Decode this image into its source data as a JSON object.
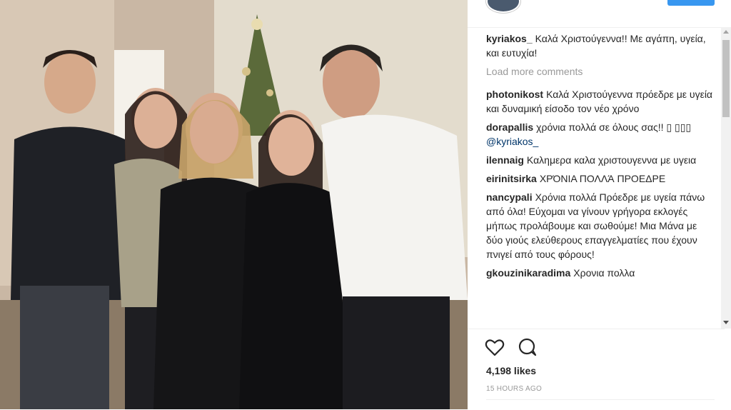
{
  "post": {
    "caption": {
      "username": "kyriakos_",
      "text": "Καλά Χριστούγεννα!! Με αγάπη, υγεία, και ευτυχία!"
    },
    "load_more": "Load more comments",
    "comments": [
      {
        "username": "photonikost",
        "text": "Καλά Χριστούγεννα πρόεδρε με υγεία και δυναμική είσοδο τον νέο χρόνο"
      },
      {
        "username": "dorapallis",
        "text": "χρόνια πολλά σε όλους σας!! ▯ ▯▯▯",
        "mention": "@kyriakos_"
      },
      {
        "username": "ilennaig",
        "text": "Καλημερα καλα χριστουγεννα με υγεια"
      },
      {
        "username": "eirinitsirka",
        "text": "ΧΡΌΝΙΑ ΠΟΛΛΆ ΠΡΟΕΔΡΕ"
      },
      {
        "username": "nancypali",
        "text": "Χρόνια πολλά Πρόεδρε με υγεία πάνω από όλα! Εύχομαι να γίνουν γρήγορα εκλογές μήπως προλάβουμε και σωθούμε! Μια Μάνα με δύο γιούς ελεύθερους επαγγελματίες που έχουν πνιγεί από τους φόρους!"
      },
      {
        "username": "gkouzinikaradima",
        "text": "Χρονια πολλα"
      }
    ],
    "likes": "4,198 likes",
    "timestamp": "15 HOURS AGO"
  },
  "icons": {
    "like": "heart-outline-icon",
    "comment": "speech-bubble-icon"
  },
  "colors": {
    "mention": "#003569",
    "muted": "#999999",
    "follow_button": "#3897f0"
  }
}
